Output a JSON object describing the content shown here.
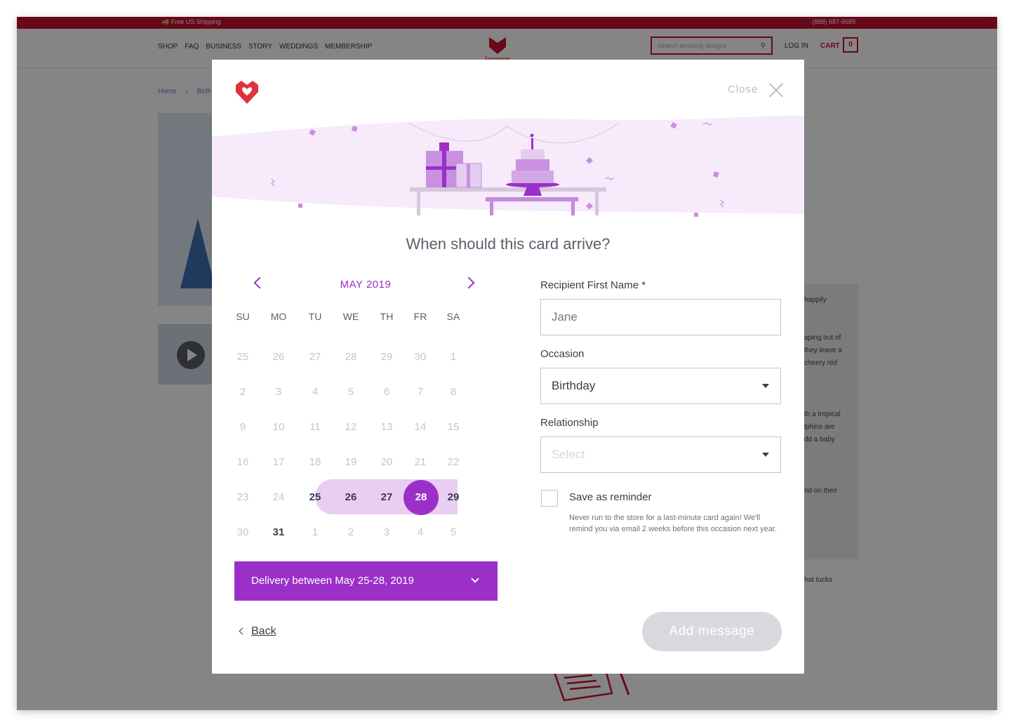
{
  "site": {
    "topbar": {
      "shipping": "Free US Shipping",
      "phone": "(888) 687-9589"
    },
    "nav": {
      "items": [
        "SHOP",
        "FAQ",
        "BUSINESS",
        "STORY",
        "WEDDINGS",
        "MEMBERSHIP"
      ],
      "logo_text": "lovepop",
      "search_placeholder": "Search amazing designs",
      "login": "LOG IN",
      "cart": "CART",
      "cart_count": "0"
    },
    "breadcrumb": {
      "home": "Home",
      "sep": "›",
      "current": "Birth"
    },
    "desc_fragments": [
      "happily",
      "aping out of",
      "they leave a",
      "cheery red",
      "th a tropical",
      "lphins are",
      "dd a baby",
      "nd on their",
      "hat tucks"
    ]
  },
  "modal": {
    "close_label": "Close",
    "heading": "When should this card arrive?",
    "calendar": {
      "month_label": "MAY 2019",
      "weekdays": [
        "SU",
        "MO",
        "TU",
        "WE",
        "TH",
        "FR",
        "SA"
      ],
      "weeks": [
        [
          "25",
          "26",
          "27",
          "28",
          "29",
          "30",
          "1"
        ],
        [
          "2",
          "3",
          "4",
          "5",
          "6",
          "7",
          "8"
        ],
        [
          "9",
          "10",
          "11",
          "12",
          "13",
          "14",
          "15"
        ],
        [
          "16",
          "17",
          "18",
          "19",
          "20",
          "21",
          "22"
        ],
        [
          "23",
          "24",
          "25",
          "26",
          "27",
          "28",
          "29"
        ],
        [
          "30",
          "31",
          "1",
          "2",
          "3",
          "4",
          "5"
        ]
      ],
      "range_days": [
        "25",
        "26",
        "27"
      ],
      "selected_day": "28",
      "available_days": [
        "29",
        "31"
      ],
      "accent_color": "#9b30c8",
      "range_color": "#e9cdf3"
    },
    "delivery_label": "Delivery between May 25-28, 2019",
    "form": {
      "recipient_label": "Recipient First Name *",
      "recipient_placeholder": "Jane",
      "occasion_label": "Occasion",
      "occasion_value": "Birthday",
      "relationship_label": "Relationship",
      "relationship_placeholder": "Select",
      "reminder_label": "Save as reminder",
      "reminder_checked": false,
      "reminder_note": "Never run to the store for a last-minute card again! We'll remind you via email 2 weeks before this occasion next year."
    },
    "back_label": "Back",
    "add_message_label": "Add message"
  }
}
